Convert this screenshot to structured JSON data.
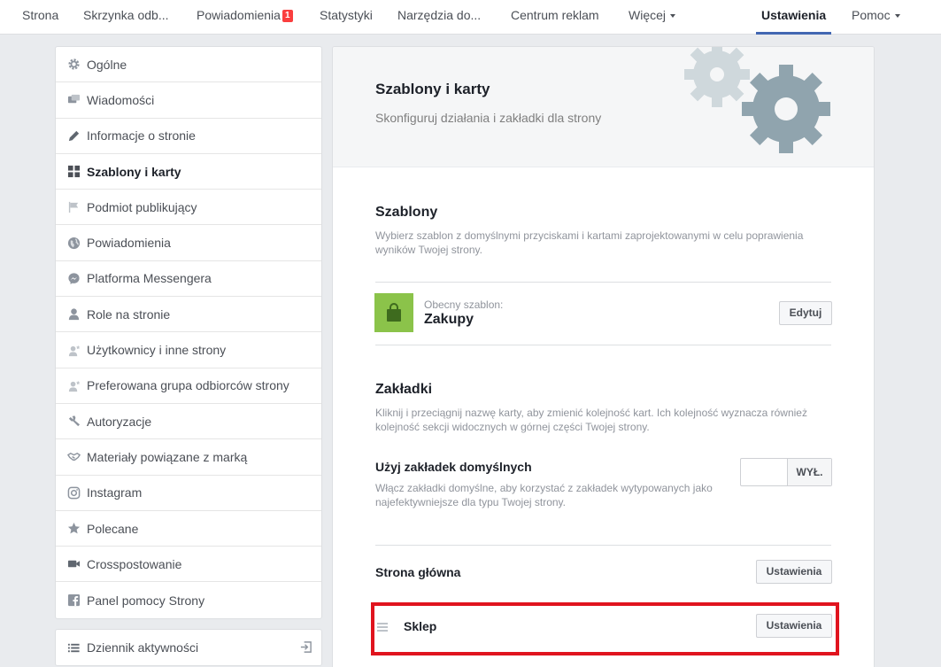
{
  "topnav": {
    "tabs": [
      {
        "label": "Strona"
      },
      {
        "label": "Skrzynka odb..."
      },
      {
        "label": "Powiadomienia",
        "badge": "1"
      },
      {
        "label": "Statystyki"
      },
      {
        "label": "Narzędzia do..."
      },
      {
        "label": "Centrum reklam"
      },
      {
        "label": "Więcej"
      },
      {
        "label": "Ustawienia"
      },
      {
        "label": "Pomoc"
      }
    ]
  },
  "sidebar": {
    "items": [
      {
        "label": "Ogólne",
        "icon": "gear-icon"
      },
      {
        "label": "Wiadomości",
        "icon": "messages-icon"
      },
      {
        "label": "Informacje o stronie",
        "icon": "pencil-icon"
      },
      {
        "label": "Szablony i karty",
        "icon": "grid-icon"
      },
      {
        "label": "Podmiot publikujący",
        "icon": "flag-icon"
      },
      {
        "label": "Powiadomienia",
        "icon": "globe-icon"
      },
      {
        "label": "Platforma Messengera",
        "icon": "messenger-icon"
      },
      {
        "label": "Role na stronie",
        "icon": "person-icon"
      },
      {
        "label": "Użytkownicy i inne strony",
        "icon": "person-star-icon"
      },
      {
        "label": "Preferowana grupa odbiorców strony",
        "icon": "person-star-icon"
      },
      {
        "label": "Autoryzacje",
        "icon": "wrench-icon"
      },
      {
        "label": "Materiały powiązane z marką",
        "icon": "handshake-icon"
      },
      {
        "label": "Instagram",
        "icon": "instagram-icon"
      },
      {
        "label": "Polecane",
        "icon": "star-icon"
      },
      {
        "label": "Crosspostowanie",
        "icon": "video-camera-icon"
      },
      {
        "label": "Panel pomocy Strony",
        "icon": "facebook-icon"
      }
    ],
    "activity_log": "Dziennik aktywności"
  },
  "main": {
    "title": "Szablony i karty",
    "subtitle": "Skonfiguruj działania i zakładki dla strony",
    "templates": {
      "title": "Szablony",
      "description": "Wybierz szablon z domyślnymi przyciskami i kartami zaprojektowanymi w celu poprawienia wyników Twojej strony.",
      "current_label": "Obecny szablon:",
      "current_name": "Zakupy",
      "edit_button": "Edytuj"
    },
    "tabs_section": {
      "title": "Zakładki",
      "description": "Kliknij i przeciągnij nazwę karty, aby zmienić kolejność kart. Ich kolejność wyznacza również kolejność sekcji widocznych w górnej części Twojej strony.",
      "default_tabs_title": "Użyj zakładek domyślnych",
      "default_tabs_desc": "Włącz zakładki domyślne, aby korzystać z zakładek wytypowanych jako najefektywniejsze dla typu Twojej strony.",
      "toggle_label": "WYŁ.",
      "rows": [
        {
          "name": "Strona główna",
          "button": "Ustawienia"
        },
        {
          "name": "Sklep",
          "button": "Ustawienia"
        }
      ]
    }
  },
  "colors": {
    "accent": "#4267b2",
    "badge": "#fa3e3e",
    "highlight": "#e0141e",
    "template_thumb": "#8bc34a",
    "gear_dark": "#90a4ae",
    "gear_light": "#cfd8dc"
  }
}
